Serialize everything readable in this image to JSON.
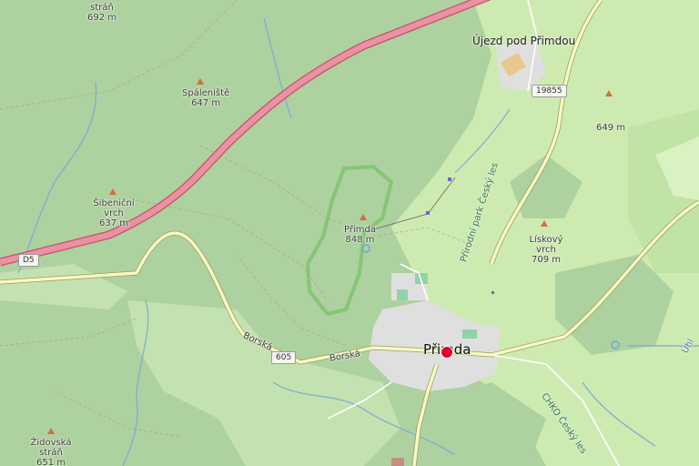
{
  "map": {
    "places": {
      "ujezd": "Újezd pod Přimdou",
      "primda_town": "Přimda"
    },
    "peaks": {
      "top_left": {
        "name": "stráň",
        "ele": "692 m"
      },
      "spaleniste": {
        "name": "Spáleniště",
        "ele": "647 m"
      },
      "sibenicni": {
        "name": "Šibeniční vrch",
        "ele": "637 m"
      },
      "primda": {
        "name": "Přimda",
        "ele": "848 m"
      },
      "liskovy": {
        "name": "Lískový vrch",
        "ele": "709 m"
      },
      "east": {
        "name": "",
        "ele": "649 m"
      },
      "zidovska": {
        "name": "Židovská stráň",
        "ele": "651 m"
      }
    },
    "roads": {
      "d5": "D5",
      "r19855": "19855",
      "r605": "605",
      "borska_1": "Borská",
      "borska_2": "Borská"
    },
    "protected": {
      "park1": "Přírodní park Český les",
      "park2": "CHKO Český les"
    },
    "edge_label": "Úhl",
    "colors": {
      "forest": "#aed1a0",
      "meadow": "#cdebb0",
      "motorway": "#e892a2",
      "motorway_casing": "#c84e6a",
      "primary_road": "#fcd6a4",
      "secondary_road": "#f7fabf",
      "water": "#6fa8dc",
      "residential": "#e0dfdf",
      "marker": "#e4002b"
    }
  }
}
